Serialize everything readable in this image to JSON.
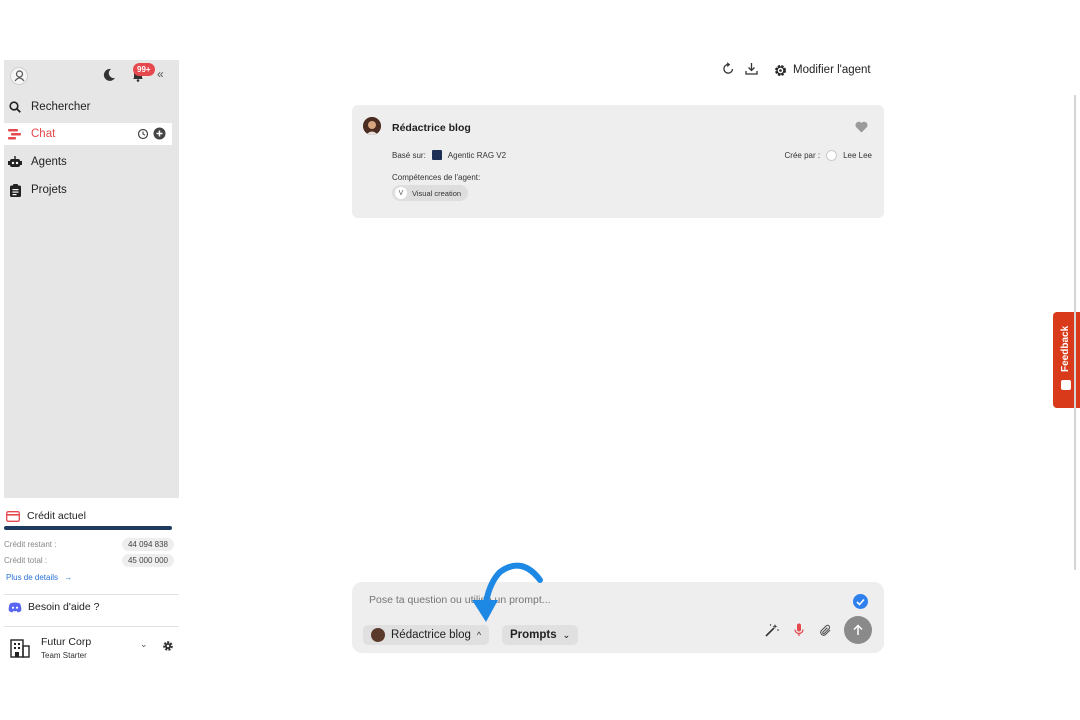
{
  "sidebar": {
    "notifications_badge": "99+",
    "collapse_label": "«",
    "items": [
      {
        "label": "Rechercher",
        "icon": "search-icon"
      },
      {
        "label": "Chat",
        "icon": "chat-icon",
        "active": true
      },
      {
        "label": "Agents",
        "icon": "robot-icon"
      },
      {
        "label": "Projets",
        "icon": "clipboard-icon"
      }
    ],
    "credit": {
      "title": "Crédit actuel",
      "remaining_label": "Crédit restant :",
      "remaining_value": "44 094 838",
      "total_label": "Crédit total :",
      "total_value": "45 000 000",
      "details_link": "Plus de details",
      "details_arrow": "→"
    },
    "help": "Besoin d'aide ?",
    "org": {
      "name": "Futur Corp",
      "plan": "Team Starter"
    }
  },
  "topbar": {
    "modify_label": "Modifier l'agent"
  },
  "agent_card": {
    "title": "Rédactrice blog",
    "based_on_label": "Basé sur:",
    "based_on_value": "Agentic RAG V2",
    "created_by_label": "Crée par :",
    "created_by_value": "Lee Lee",
    "skills_label": "Compétences de l'agent:",
    "skill_initial": "V",
    "skill": "Visual creation"
  },
  "composer": {
    "placeholder": "Pose ta question ou utilise un prompt...",
    "agent_chip": "Rédactrice blog",
    "prompts_chip": "Prompts",
    "chevron_up": "^",
    "chevron_down": "⌄"
  },
  "feedback": {
    "label": "Feedback"
  },
  "colors": {
    "accent_red": "#e5484d",
    "link_blue": "#2b6fd6",
    "feedback_orange": "#d93a1a",
    "arrow_blue": "#1e88e5"
  }
}
